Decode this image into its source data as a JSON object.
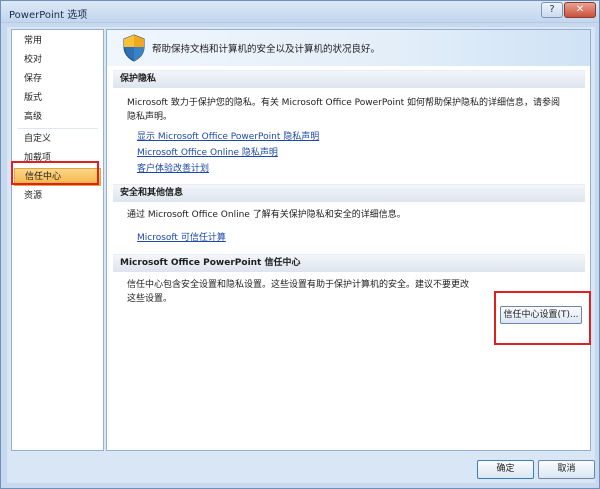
{
  "window": {
    "title": "PowerPoint 选项",
    "help_glyph": "?",
    "close_glyph": "✕"
  },
  "nav": {
    "items": [
      {
        "label": "常用"
      },
      {
        "label": "校对"
      },
      {
        "label": "保存"
      },
      {
        "label": "版式"
      },
      {
        "label": "高级"
      },
      {
        "label": "自定义"
      },
      {
        "label": "加载项"
      },
      {
        "label": "信任中心",
        "selected": true
      },
      {
        "label": "资源"
      }
    ]
  },
  "banner": {
    "icon": "shield-icon",
    "text": "帮助保持文档和计算机的安全以及计算机的状况良好。"
  },
  "sections": {
    "privacy": {
      "header": "保护隐私",
      "body": "Microsoft 致力于保护您的隐私。有关 Microsoft Office PowerPoint 如何帮助保护隐私的详细信息，请参阅隐私声明。",
      "links": [
        "显示 Microsoft Office PowerPoint 隐私声明",
        "Microsoft Office Online 隐私声明",
        "客户体验改善计划"
      ]
    },
    "security": {
      "header": "安全和其他信息",
      "body": "通过 Microsoft Office Online 了解有关保护隐私和安全的详细信息。",
      "links": [
        "Microsoft 可信任计算"
      ]
    },
    "trust_center": {
      "header": "Microsoft Office PowerPoint 信任中心",
      "body": "信任中心包含安全设置和隐私设置。这些设置有助于保护计算机的安全。建议不要更改这些设置。",
      "button_label": "信任中心设置(T)..."
    }
  },
  "footer": {
    "ok_label": "确定",
    "cancel_label": "取消"
  },
  "colors": {
    "selected_nav": "#f5b345",
    "link": "#1f49a8",
    "highlight_box": "#e02020"
  }
}
